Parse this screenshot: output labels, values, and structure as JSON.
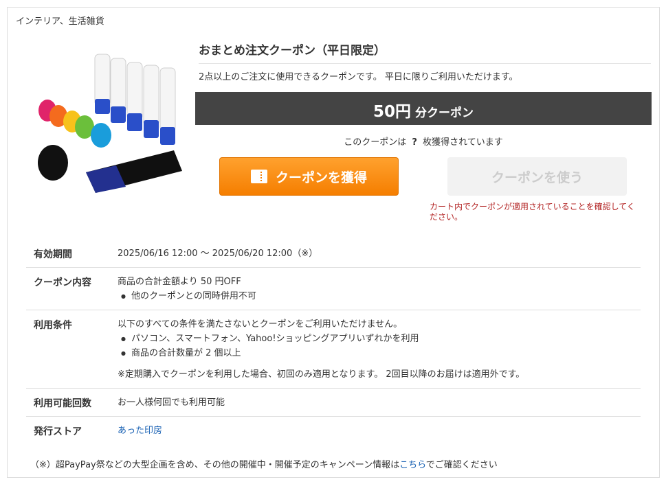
{
  "category": "インテリア、生活雑貨",
  "product_image_alt": "",
  "coupon": {
    "title": "おまとめ注文クーポン（平日限定）",
    "description": "2点以上のご注文に使用できるクーポンです。 平日に限りご利用いただけます。",
    "discount_amount": "50円",
    "discount_suffix": "分クーポン",
    "acquired_prefix": "このクーポンは",
    "acquired_count": "?",
    "acquired_suffix": "枚獲得されています",
    "get_button_label": "クーポンを獲得",
    "use_button_label": "クーポンを使う",
    "cart_note": "カート内でクーポンが適用されていることを確認してください。"
  },
  "details": {
    "period_label": "有効期間",
    "period_value": "2025/06/16 12:00 〜 2025/06/20 12:00（※）",
    "content_label": "クーポン内容",
    "content_value": "商品の合計金額より 50 円OFF",
    "content_bullets": [
      "他のクーポンとの同時併用不可"
    ],
    "conditions_label": "利用条件",
    "conditions_intro": "以下のすべての条件を満たさないとクーポンをご利用いただけません。",
    "conditions_bullets": [
      "パソコン、スマートフォン、Yahoo!ショッピングアプリいずれかを利用",
      "商品の合計数量が 2 個以上"
    ],
    "conditions_note": "※定期購入でクーポンを利用した場合、初回のみ適用となります。 2回目以降のお届けは適用外です。",
    "usage_label": "利用可能回数",
    "usage_value": "お一人様何回でも利用可能",
    "store_label": "発行ストア",
    "store_value": "あった印房"
  },
  "footer": {
    "text_before": "（※）超PayPay祭などの大型企画を含め、その他の開催中・開催予定のキャンペーン情報は",
    "link_text": "こちら",
    "text_after": "でご確認ください"
  },
  "colors": {
    "band_bg": "#444444",
    "get_button": "#f57e00",
    "note_red": "#b22222",
    "link_blue": "#1a62b4"
  }
}
